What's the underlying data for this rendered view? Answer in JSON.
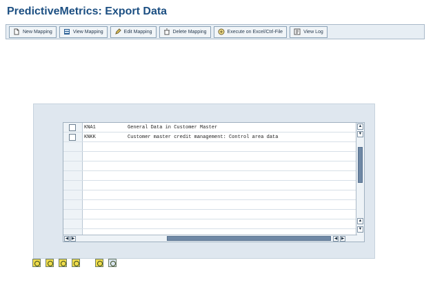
{
  "title": "PredictiveMetrics: Export Data",
  "toolbar": {
    "items": [
      {
        "label": "New Mapping",
        "icon": "document-icon"
      },
      {
        "label": "View Mapping",
        "icon": "view-mapping-icon"
      },
      {
        "label": "Edit Mapping",
        "icon": "pencil-icon"
      },
      {
        "label": "Delete Mapping",
        "icon": "delete-icon"
      },
      {
        "label": "Execute on Excel/Ctrl-File",
        "icon": "execute-icon"
      },
      {
        "label": "View Log",
        "icon": "log-icon"
      }
    ]
  },
  "table": {
    "rows": [
      {
        "code": "KNA1",
        "description": "General Data in Customer Master"
      },
      {
        "code": "KNKK",
        "description": "Customer master credit management: Control area data"
      }
    ],
    "empty_rows": 9
  },
  "actions": [
    {
      "icon": "refresh-icon"
    },
    {
      "icon": "reload-icon"
    },
    {
      "icon": "copy-icon"
    },
    {
      "icon": "export-icon"
    },
    {
      "icon": "select-icon"
    },
    {
      "icon": "details-icon"
    }
  ],
  "colors": {
    "title": "#1c4f82",
    "toolbar_bg": "#e7eef4",
    "panel_bg": "#dfe7ef",
    "scroll_thumb": "#6f88a5"
  }
}
